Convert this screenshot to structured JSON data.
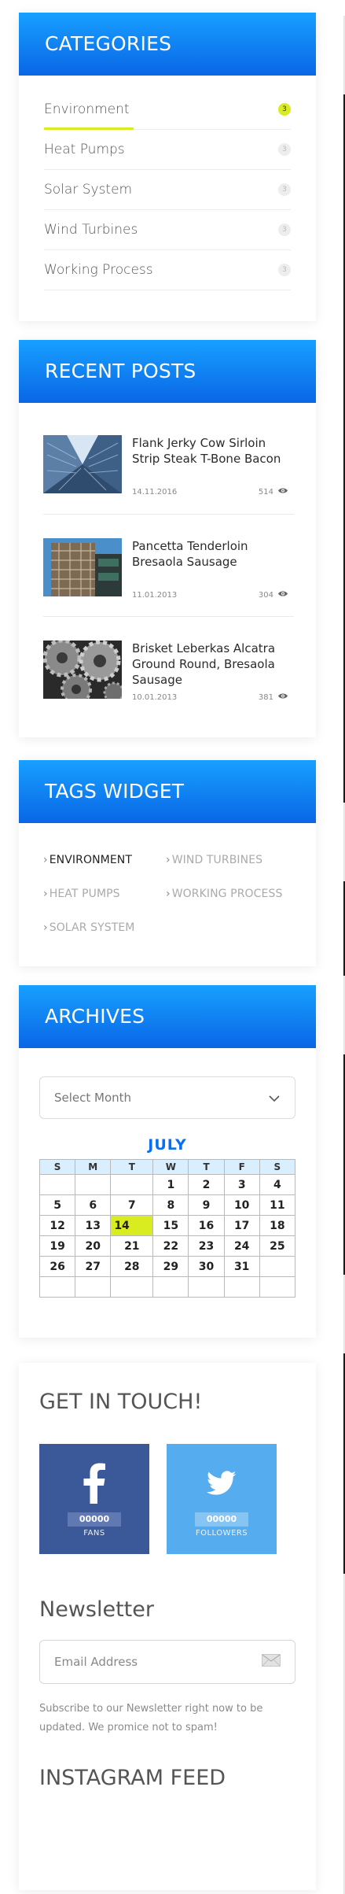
{
  "categories": {
    "title": "CATEGORIES",
    "items": [
      {
        "label": "Environment",
        "count": "3"
      },
      {
        "label": "Heat Pumps",
        "count": "3"
      },
      {
        "label": "Solar System",
        "count": "3"
      },
      {
        "label": "Wind Turbines",
        "count": "3"
      },
      {
        "label": "Working Process",
        "count": "3"
      }
    ]
  },
  "recent_posts": {
    "title": "RECENT POSTS",
    "posts": [
      {
        "title": "Flank Jerky Cow Sirloin Strip Steak T-Bone Bacon",
        "date": "14.11.2016",
        "views": "514",
        "thumb_icon": "skyscrapers-image"
      },
      {
        "title": "Pancetta Tenderloin Bresaola Sausage",
        "date": "11.01.2013",
        "views": "304",
        "thumb_icon": "building-scaffold-image"
      },
      {
        "title": "Brisket Leberkas Alcatra Ground Round, Bresaola Sausage",
        "date": "10.01.2013",
        "views": "381",
        "thumb_icon": "gears-image"
      }
    ]
  },
  "tags": {
    "title": "TAGS WIDGET",
    "items": [
      "ENVIRONMENT",
      "WIND TURBINES",
      "HEAT PUMPS",
      "WORKING PROCESS",
      "SOLAR SYSTEM"
    ]
  },
  "archives": {
    "title": "ARCHIVES",
    "select_value": "Select Month",
    "month": "JULY",
    "weekdays": [
      "S",
      "M",
      "T",
      "W",
      "T",
      "F",
      "S"
    ],
    "weeks": [
      [
        "",
        "",
        "",
        "1",
        "2",
        "3",
        "4"
      ],
      [
        "5",
        "6",
        "7",
        "8",
        "9",
        "10",
        "11"
      ],
      [
        "12",
        "13",
        "14",
        "15",
        "16",
        "17",
        "18"
      ],
      [
        "19",
        "20",
        "21",
        "22",
        "23",
        "24",
        "25"
      ],
      [
        "26",
        "27",
        "28",
        "29",
        "30",
        "31",
        ""
      ],
      [
        "",
        "",
        "",
        "",
        "",
        "",
        ""
      ]
    ],
    "today": "14"
  },
  "touch": {
    "title": "GET IN TOUCH!",
    "facebook": {
      "count": "00000",
      "label": "FANS"
    },
    "twitter": {
      "count": "00000",
      "label": "FOLLOWERS"
    },
    "newsletter_title": "Newsletter",
    "email_placeholder": "Email Address",
    "newsletter_text": "Subscribe to our Newsletter right now to be updated. We promice not to spam!",
    "instagram_title": "INSTAGRAM FEED"
  },
  "colors": {
    "header_top": "#17a0ff",
    "header_bottom": "#0a66e6",
    "accent_lime": "#d8ec20",
    "facebook": "#3b5999",
    "twitter": "#55acee",
    "calendar_month": "#0a6ff0"
  }
}
